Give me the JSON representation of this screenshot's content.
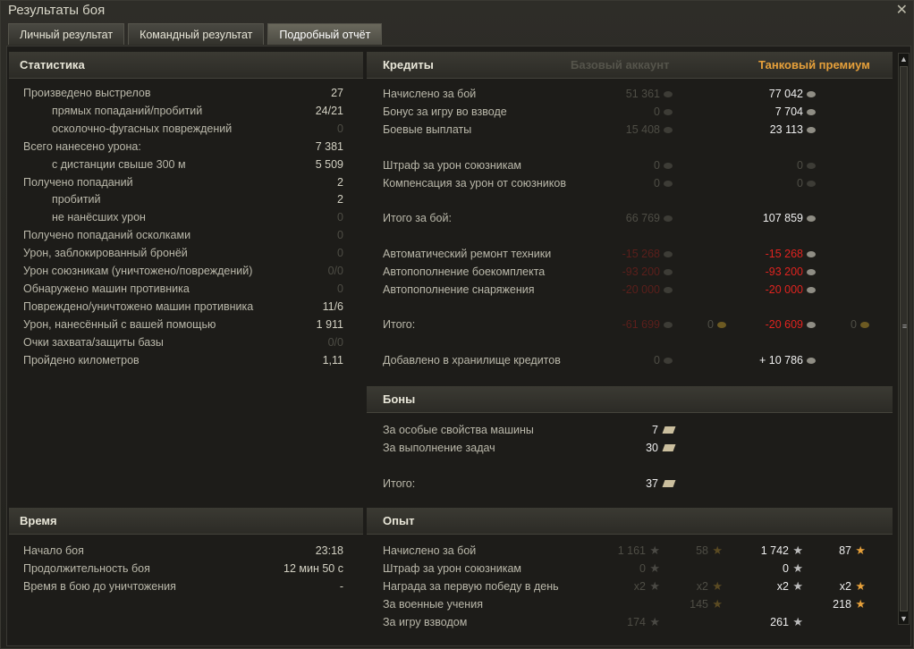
{
  "window": {
    "title": "Результаты боя",
    "close": "✕"
  },
  "tabs": [
    "Личный результат",
    "Командный результат",
    "Подробный отчёт"
  ],
  "statistics": {
    "title": "Статистика",
    "rows": [
      {
        "label": "Произведено выстрелов",
        "value": "27",
        "indent": false,
        "dim": false
      },
      {
        "label": "прямых попаданий/пробитий",
        "value": "24/21",
        "indent": true,
        "dim": false
      },
      {
        "label": "осколочно-фугасных повреждений",
        "value": "0",
        "indent": true,
        "dim": true
      },
      {
        "label": "Всего нанесено урона:",
        "value": "7 381",
        "indent": false,
        "dim": false
      },
      {
        "label": "с дистанции свыше 300 м",
        "value": "5 509",
        "indent": true,
        "dim": false
      },
      {
        "label": "Получено попаданий",
        "value": "2",
        "indent": false,
        "dim": false
      },
      {
        "label": "пробитий",
        "value": "2",
        "indent": true,
        "dim": false
      },
      {
        "label": "не нанёсших урон",
        "value": "0",
        "indent": true,
        "dim": true
      },
      {
        "label": "Получено попаданий осколками",
        "value": "0",
        "indent": false,
        "dim": true
      },
      {
        "label": "Урон, заблокированный бронёй",
        "value": "0",
        "indent": false,
        "dim": true
      },
      {
        "label": "Урон союзникам (уничтожено/повреждений)",
        "value": "0/0",
        "indent": false,
        "dim": true
      },
      {
        "label": "Обнаружено машин противника",
        "value": "0",
        "indent": false,
        "dim": true
      },
      {
        "label": "Повреждено/уничтожено машин противника",
        "value": "11/6",
        "indent": false,
        "dim": false
      },
      {
        "label": "Урон, нанесённый с вашей помощью",
        "value": "1 911",
        "indent": false,
        "dim": false
      },
      {
        "label": "Очки захвата/защиты базы",
        "value": "0/0",
        "indent": false,
        "dim": true
      },
      {
        "label": "Пройдено километров",
        "value": "1,11",
        "indent": false,
        "dim": false
      }
    ]
  },
  "time": {
    "title": "Время",
    "rows": [
      {
        "label": "Начало боя",
        "value": "23:18"
      },
      {
        "label": "Продолжительность боя",
        "value": "12 мин 50 с"
      },
      {
        "label": "Время в бою до уничтожения",
        "value": "-"
      }
    ]
  },
  "credits": {
    "title": "Кредиты",
    "base_header": "Базовый аккаунт",
    "premium_header": "Танковый премиум",
    "rows": [
      {
        "label": "Начислено за бой",
        "base": "51 361",
        "prem": "77 042",
        "baseStyle": "dim",
        "premStyle": "white"
      },
      {
        "label": "Бонус за игру во взводе",
        "base": "0",
        "prem": "7 704",
        "baseStyle": "dim",
        "premStyle": "white"
      },
      {
        "label": "Боевые выплаты",
        "base": "15 408",
        "prem": "23 113",
        "baseStyle": "dim",
        "premStyle": "white"
      },
      {
        "label": "Штраф за урон союзникам",
        "base": "0",
        "prem": "0",
        "baseStyle": "dim",
        "premStyle": "dim"
      },
      {
        "label": "Компенсация за урон от союзников",
        "base": "0",
        "prem": "0",
        "baseStyle": "dim",
        "premStyle": "dim"
      },
      {
        "label": "Итого за бой:",
        "base": "66 769",
        "prem": "107 859",
        "baseStyle": "dim",
        "premStyle": "white"
      },
      {
        "label": "Автоматический ремонт техники",
        "base": "-15 268",
        "prem": "-15 268",
        "baseStyle": "redDim",
        "premStyle": "red"
      },
      {
        "label": "Автопополнение боекомплекта",
        "base": "-93 200",
        "prem": "-93 200",
        "baseStyle": "redDim",
        "premStyle": "red"
      },
      {
        "label": "Автопополнение снаряжения",
        "base": "-20 000",
        "prem": "-20 000",
        "baseStyle": "redDim",
        "premStyle": "red"
      },
      {
        "label": "Итого:",
        "base": "-61 699",
        "prem": "-20 609",
        "baseStyle": "redDim",
        "premStyle": "red",
        "baseGold": "0",
        "premGold": "0"
      },
      {
        "label": "Добавлено в хранилище кредитов",
        "base": "0",
        "prem": "+ 10 786",
        "baseStyle": "dim",
        "premStyle": "white"
      }
    ]
  },
  "bonds": {
    "title": "Боны",
    "rows": [
      {
        "label": "За особые свойства машины",
        "value": "7"
      },
      {
        "label": "За выполнение задач",
        "value": "30"
      },
      {
        "label": "Итого:",
        "value": "37"
      }
    ]
  },
  "experience": {
    "title": "Опыт",
    "rows": [
      {
        "label": "Начислено за бой",
        "b1": "1 161",
        "b2": "58",
        "p1": "1 742",
        "p2": "87"
      },
      {
        "label": "Штраф за урон союзникам",
        "b1": "0",
        "b2": "",
        "p1": "0",
        "p2": ""
      },
      {
        "label": "Награда за первую победу в день",
        "b1": "x2",
        "b2": "x2",
        "p1": "x2",
        "p2": "x2"
      },
      {
        "label": "За военные учения",
        "b1": "",
        "b2": "145",
        "p1": "",
        "p2": "218"
      },
      {
        "label": "За игру взводом",
        "b1": "174",
        "b2": "",
        "p1": "261",
        "p2": ""
      }
    ]
  },
  "colors": {
    "accent": "#e6a03a",
    "red": "#e0231f",
    "panel": "#2c2b26"
  }
}
